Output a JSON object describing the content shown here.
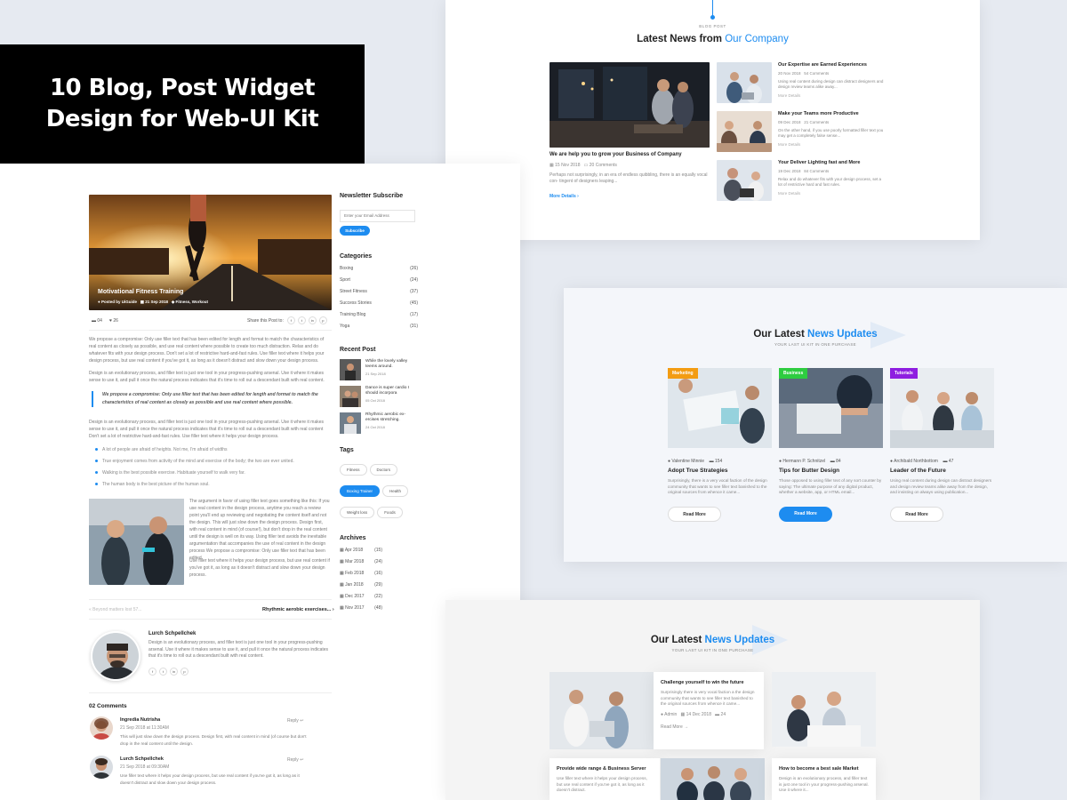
{
  "hero": {
    "line1": "10 Blog, Post Widget",
    "line2": "Design for Web-UI Kit"
  },
  "colors": {
    "accent": "#1d8cf0",
    "marketing": "#f39c12",
    "business": "#2ecc40",
    "tutorials": "#8e1ee0"
  },
  "blog": {
    "image_title": "Motivational Fitness Training",
    "meta": {
      "author": "Posted by UiGuide",
      "date": "21 Sep 2018",
      "tags": "Fitness, Workout"
    },
    "comments_count": "04",
    "likes": "26",
    "share_label": "Share this Post to:",
    "paragraph1": "We propose a compromise: Only use filler text that has been edited for length and format to match the characteristics of real content as closely as possible, and use real content where possible to create too much distraction. Relax and do whatever fits with your design process. Don't set a lot of restrictive hard-and-fast rules. Use filler text where it helps your design process, but use real content if you've got it, as long as it doesn't distract and slow down your design process.",
    "paragraph2": "Design is an evolutionary process, and filler text is just one tool in your progress-pushing arsenal. Use it where it makes sense to use it, and pull it once the natural process indicates that it's time to roll out a descendant built with real content.",
    "quote": "We propose a compromise: Only use filler text that has been edited for length and format to match the characteristics of real content as closely as possible and use real content where possible.",
    "paragraph3": "Design is an evolutionary process, and filler text is just one tool in your progress-pushing arsenal. Use it where it makes sense to use it, and pull it once the natural process indicates that it's time to roll out a descendant built with real content Don't set a lot of restrictive hard-and-fast rules. Use filler text where it helps your design process.",
    "bullets": [
      "A lot of people are afraid of heights. Not me, I'm afraid of widths",
      "True enjoyment comes from activity of the mind and exercise of the body; the two are ever united.",
      "Walking is the best possible exercise. Habituate yourself to walk very far.",
      "The human body is the best picture of the human soul."
    ],
    "paragraph4": "The argument in favor of using filler text goes something like this: If you use real content in the design process, anytime you reach a review point you'll end up reviewing and negotiating the content itself and not the design. This will just slow down the design process. Design first, with real content in mind (of course!), but don't drop in the real content until the design is well on its way. Using filler text avoids the inevitable argumentation that accompanies the use of real content in the design process We propose a compromise: Only use filler text that has been edited.",
    "paragraph5": "Use filler text where it helps your design process, but use real content if you've got it, as long as it doesn't distract and slow down your design process.",
    "prev_post": "« Beyond matters lost 57...",
    "next_post": "Rhythmic aerobic exercises...",
    "author_name": "Lurch Schpellchek",
    "author_bio": "Design is an evolutionary process, and filler text is just one tool in your progress-pushing arsenal. Use it where it makes sense to use it, and pull it once the natural process indicates that it's time to roll out a descendant built with real content.",
    "comments_title": "02 Comments",
    "comments": [
      {
        "name": "Ingredia Nutrisha",
        "date": "21 Sep 2018 at 11:30AM",
        "reply": "Reply",
        "text": "This will just slow down the design process. Design first, with real content in mind (of course but don't drop in the real content until the design."
      },
      {
        "name": "Lurch Schpellchek",
        "date": "21 Sep 2018 at 09:30AM",
        "reply": "Reply",
        "text": "Use filler text where it helps your design process, but use real content if you've got it, as long as it doesn't distract and slow down your design process."
      }
    ]
  },
  "sidebar": {
    "newsletter_title": "Newsletter Subscribe",
    "email_placeholder": "Enter your Email Address",
    "subscribe": "Subscribe",
    "categories_title": "Categories",
    "categories": [
      {
        "name": "Boxing",
        "count": "(26)"
      },
      {
        "name": "Sport",
        "count": "(24)"
      },
      {
        "name": "Street Fitness",
        "count": "(37)"
      },
      {
        "name": "Success Stories",
        "count": "(45)"
      },
      {
        "name": "Training Blog",
        "count": "(17)"
      },
      {
        "name": "Yoga",
        "count": "(31)"
      }
    ],
    "recent_title": "Recent Post",
    "recent": [
      {
        "title": "While the lovely valley teems around.",
        "date": "21 Sep 2018"
      },
      {
        "title": "Dance is super cardio I should incorpora",
        "date": "05 Oct 2018"
      },
      {
        "title": "Rhythmic aerobic ex- ercises stretching.",
        "date": "24 Oct 2018"
      }
    ],
    "tags_title": "Tags",
    "tags": [
      "Fitness",
      "Doctors",
      "Boxing Trainer",
      "Health",
      "Weight loss",
      "Foods"
    ],
    "archives_title": "Archives",
    "archives": [
      {
        "month": "Apr 2018",
        "count": "(15)"
      },
      {
        "month": "Mar 2018",
        "count": "(24)"
      },
      {
        "month": "Feb 2018",
        "count": "(16)"
      },
      {
        "month": "Jan 2018",
        "count": "(29)"
      },
      {
        "month": "Dec 2017",
        "count": "(22)"
      },
      {
        "month": "Nov 2017",
        "count": "(48)"
      }
    ]
  },
  "panel1": {
    "kicker": "BLOG POST",
    "title_plain": "Latest News from ",
    "title_accent": "Our Company",
    "main": {
      "title": "We are help you to grow your Business of Company",
      "date": "15 Nov 2018",
      "comments": "20 Comments",
      "excerpt": "Perhaps not surprisingly, in an era of endless quibbling, there is an equally vocal con- tingent of designers leaping...",
      "more": "More Details"
    },
    "side": [
      {
        "title": "Our Expertise are Earned Experiences",
        "date": "20 Nov 2018",
        "comments": "54 Comments",
        "excerpt": "Using real content during design can distract designers and design review teams alike away...",
        "more": "More Details"
      },
      {
        "title": "Make your Teams more Productive",
        "date": "09 Dec 2018",
        "comments": "21 Comments",
        "excerpt": "On the other hand, if you use poorly formatted filler text you may get a completely false sense...",
        "more": "More Details"
      },
      {
        "title": "Your Deliver Lighting fast and More",
        "date": "19 Dec 2018",
        "comments": "84 Comments",
        "excerpt": "Relax and do whatever fits with your design process, set a lot of restrictive hard and fast rules.",
        "more": "More Details"
      }
    ]
  },
  "panel2": {
    "title_plain": "Our Latest ",
    "title_accent": "News Updates",
    "subtitle": "YOUR LAST UI KIT IN ONE PURCHASE",
    "cards": [
      {
        "badge": "Marketing",
        "author": "Valentine Minnie",
        "comments": "154",
        "title": "Adopt True Strategies",
        "text": "Surprisingly, there is a very vocal faction of the design community that wants to see filler text banished to the original sources from whence it came...",
        "button": "Read More"
      },
      {
        "badge": "Business",
        "author": "Hermann P. Schnitzel",
        "comments": "84",
        "title": "Tips for Butter Design",
        "text": "Those opposed to using filler text of any sort counter by saying: The ultimate purpose of any digital product, whether a website, app, or HTML email...",
        "button": "Read More"
      },
      {
        "badge": "Tutorials",
        "author": "Archibald Northbottom",
        "comments": "47",
        "title": "Leader of the Future",
        "text": "Using real content during design can distract designers and design review teams alike away from the design, and insisting on always using publication...",
        "button": "Read More"
      }
    ]
  },
  "panel3": {
    "title_plain": "Our Latest ",
    "title_accent": "News Updates",
    "subtitle": "YOUR LAST UI KIT IN ONE PURCHASE",
    "card1": {
      "title": "Challenge yourself to win the future",
      "text": "Surprisingly there is very vocal faction a the design community that wants to see filler text banished to the original sources from whence it came...",
      "author": "Admin",
      "date": "14 Dec 2018",
      "comments": "24",
      "more": "Read More"
    },
    "card2": {
      "title": "Provide wide range & Business Server",
      "text": "Use filler text where it helps your design process, but use real content if you've got it, as long as it doesn't distract."
    },
    "card3": {
      "title": "How to become a best sale Market",
      "text": "Design is an evolutionary process, and filler text is just one tool in your progress-pushing arsenal. Use it where it..."
    }
  }
}
